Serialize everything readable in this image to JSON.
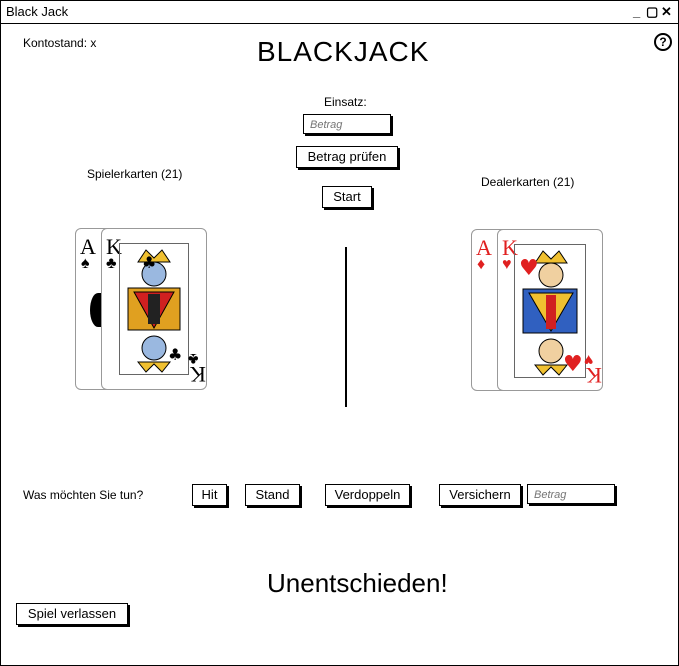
{
  "window": {
    "title": "Black Jack",
    "controls": {
      "minimize": "_",
      "restore": "▢",
      "close": "✕"
    }
  },
  "header": {
    "balance": "Kontostand: x",
    "title": "BLACKJACK",
    "help_icon": "help-icon"
  },
  "bet": {
    "label": "Einsatz:",
    "placeholder": "Betrag",
    "check_label": "Betrag prüfen",
    "start_label": "Start"
  },
  "player": {
    "label": "Spielerkarten (21)",
    "cards": [
      {
        "rank": "A",
        "suit": "♠"
      },
      {
        "rank": "K",
        "suit": "♣"
      }
    ]
  },
  "dealer": {
    "label": "Dealerkarten (21)",
    "cards": [
      {
        "rank": "A",
        "suit": "♦"
      },
      {
        "rank": "K",
        "suit": "♥"
      }
    ]
  },
  "actions": {
    "prompt": "Was möchten Sie tun?",
    "hit": "Hit",
    "stand": "Stand",
    "double": "Verdoppeln",
    "insure": "Versichern",
    "insure_placeholder": "Betrag"
  },
  "result": "Unentschieden!",
  "leave_label": "Spiel verlassen",
  "colors": {
    "red_suit": "#e02020",
    "black_suit": "#000000"
  }
}
